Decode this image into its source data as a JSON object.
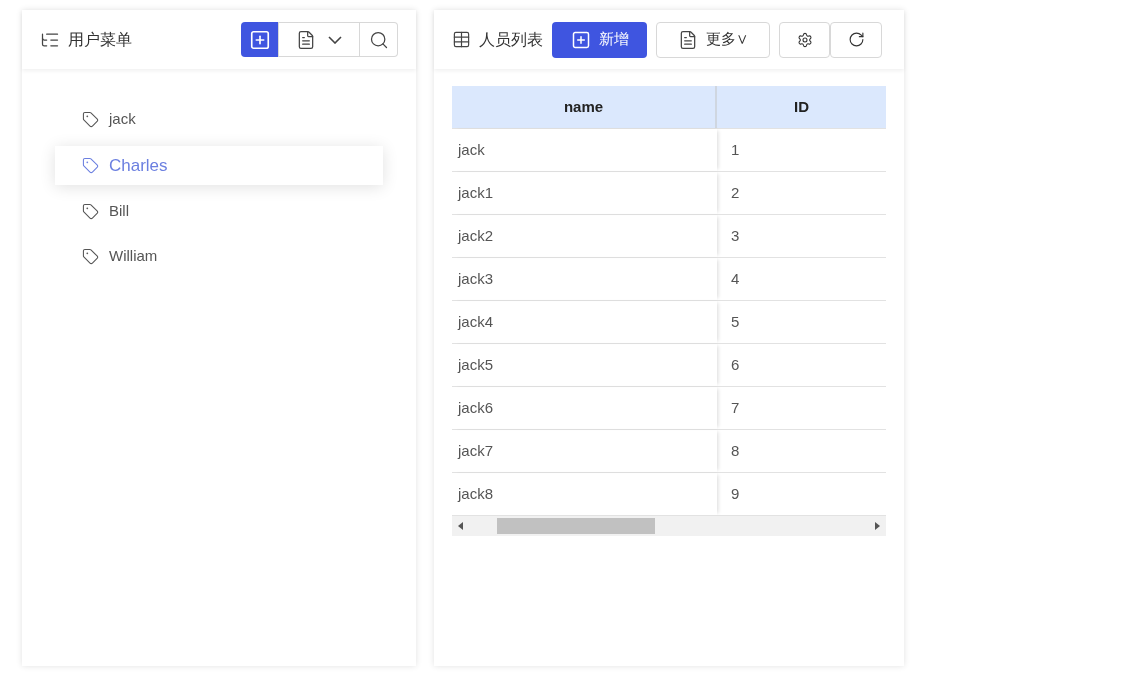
{
  "menu_panel": {
    "title": "用户菜单",
    "items": [
      {
        "label": "jack",
        "selected": false
      },
      {
        "label": "Charles",
        "selected": true
      },
      {
        "label": "Bill",
        "selected": false
      },
      {
        "label": "William",
        "selected": false
      }
    ]
  },
  "list_panel": {
    "title": "人员列表",
    "add_button": "新增",
    "more_button": "更多∨",
    "table": {
      "columns": [
        "name",
        "ID"
      ],
      "rows": [
        [
          "jack",
          "1"
        ],
        [
          "jack1",
          "2"
        ],
        [
          "jack2",
          "3"
        ],
        [
          "jack3",
          "4"
        ],
        [
          "jack4",
          "5"
        ],
        [
          "jack5",
          "6"
        ],
        [
          "jack6",
          "7"
        ],
        [
          "jack7",
          "8"
        ],
        [
          "jack8",
          "9"
        ]
      ]
    }
  }
}
